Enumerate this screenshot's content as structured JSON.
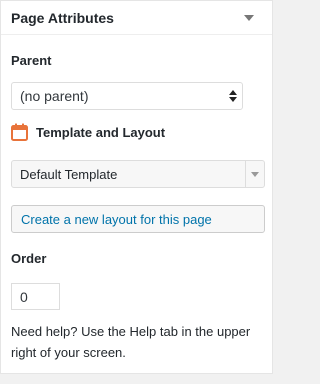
{
  "panel": {
    "title": "Page Attributes"
  },
  "parent": {
    "label": "Parent",
    "selected": "(no parent)"
  },
  "template": {
    "heading": "Template and Layout",
    "selected": "Default Template",
    "icon": "calendar-icon",
    "icon_color": "#e8733a"
  },
  "layout": {
    "create_link": "Create a new layout for this page"
  },
  "order": {
    "label": "Order",
    "value": "0"
  },
  "help": {
    "text": "Need help? Use the Help tab in the upper right of your screen."
  }
}
